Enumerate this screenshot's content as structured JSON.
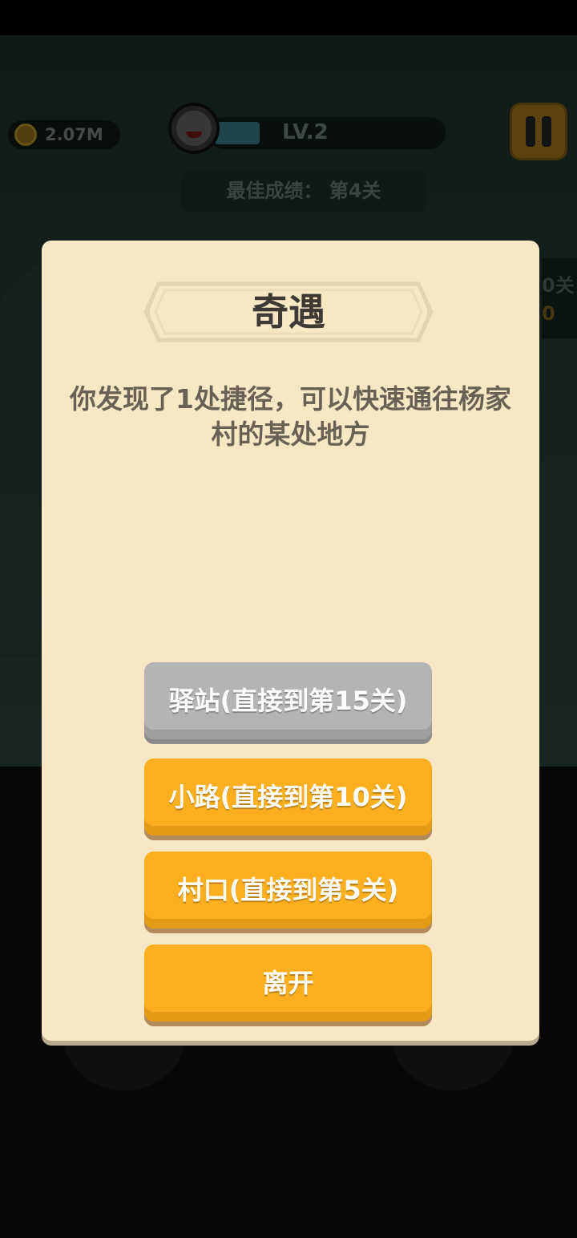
{
  "hud": {
    "coins": "2.07M",
    "level": "LV.2",
    "level_progress": 0.2,
    "best_score": "最佳成绩： 第4关",
    "side_label": "0关",
    "side_value": "0"
  },
  "dialog": {
    "title": "奇遇",
    "message": "你发现了1处捷径，可以快速通往杨家村的某处地方",
    "options": [
      {
        "label": "驿站(直接到第15关)",
        "state": "disabled",
        "color": "#b4b4b4"
      },
      {
        "label": "小路(直接到第10关)",
        "state": "enabled",
        "color": "#fbaf1f"
      },
      {
        "label": "村口(直接到第5关)",
        "state": "enabled",
        "color": "#fbaf1f"
      },
      {
        "label": "离开",
        "state": "enabled",
        "color": "#fbaf1f"
      }
    ]
  },
  "icons": [
    "coin-icon",
    "avatar-icon",
    "pause-icon"
  ]
}
